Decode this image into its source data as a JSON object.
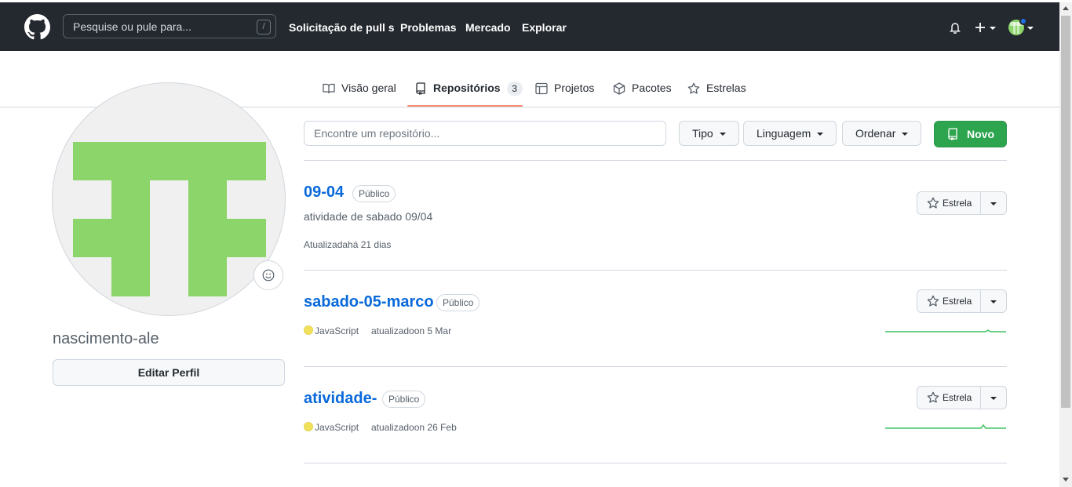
{
  "header": {
    "search_placeholder": "Pesquise ou pule para...",
    "search_shortcut": "/",
    "nav": [
      "Solicitação de pull s",
      "Problemas",
      "Mercado",
      "Explorar"
    ]
  },
  "tabs": [
    {
      "label": "Visão geral",
      "icon": "book-icon"
    },
    {
      "label": "Repositórios",
      "icon": "repo-icon",
      "count": "3",
      "selected": true
    },
    {
      "label": "Projetos",
      "icon": "table-icon"
    },
    {
      "label": "Pacotes",
      "icon": "package-icon"
    },
    {
      "label": "Estrelas",
      "icon": "star-icon"
    }
  ],
  "profile": {
    "username": "nascimento-ale",
    "edit_label": "Editar Perfil",
    "avatar_color": "#8cd56a"
  },
  "filters": {
    "find_placeholder": "Encontre um repositório...",
    "type_label": "Tipo",
    "language_label": "Linguagem",
    "sort_label": "Ordenar",
    "new_label": "Novo"
  },
  "repos": [
    {
      "name": "09-04",
      "visibility": "Público",
      "description": "atividade de sabado 09/04",
      "updated": "Atualizadahá 21 dias",
      "star_label": "Estrela"
    },
    {
      "name": "sabado-05-marco",
      "visibility": "Público",
      "language": "JavaScript",
      "updated": "atualizadoon 5 Mar",
      "star_label": "Estrela"
    },
    {
      "name": "atividade-",
      "visibility": "Público",
      "language": "JavaScript",
      "updated": "atualizadoon 26 Feb",
      "star_label": "Estrela"
    }
  ],
  "colors": {
    "header_bg": "#24292f",
    "link_blue": "#0969da",
    "new_button_green": "#2da44e",
    "javascript_yellow": "#f1e05a",
    "tab_underline": "#fd8c73"
  }
}
